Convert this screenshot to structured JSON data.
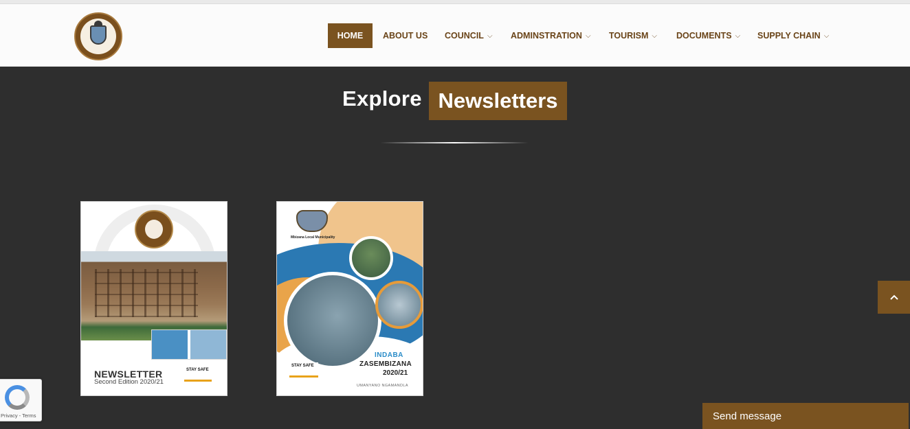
{
  "nav": {
    "items": [
      {
        "label": "HOME",
        "active": true
      },
      {
        "label": "ABOUT US",
        "dropdown": false
      },
      {
        "label": "COUNCIL",
        "dropdown": true
      },
      {
        "label": "ADMINSTRATION",
        "dropdown": true
      },
      {
        "label": "TOURISM",
        "dropdown": true
      },
      {
        "label": "DOCUMENTS",
        "dropdown": true
      },
      {
        "label": "SUPPLY CHAIN",
        "dropdown": true
      }
    ],
    "chevron": "⌵"
  },
  "heading": {
    "explore": "Explore",
    "highlight": "Newsletters"
  },
  "newsletters": [
    {
      "title": "NEWSLETTER",
      "subtitle": "Second Edition 2020/21"
    },
    {
      "municipality": "Mbizana Local Municipality",
      "line1": "INDABA",
      "line2": "ZASEMBIZANA",
      "line3": "2020/21",
      "footer": "UMANYANO NGAMANDLA"
    }
  ],
  "scroll_top_icon": "chevron-up",
  "recaptcha": {
    "text": "Privacy - Terms"
  },
  "chat": {
    "label": "Send message"
  },
  "colors": {
    "brand_brown": "#7a5320",
    "background_dark": "#2e2e2e",
    "nav_text": "#6a4418"
  }
}
